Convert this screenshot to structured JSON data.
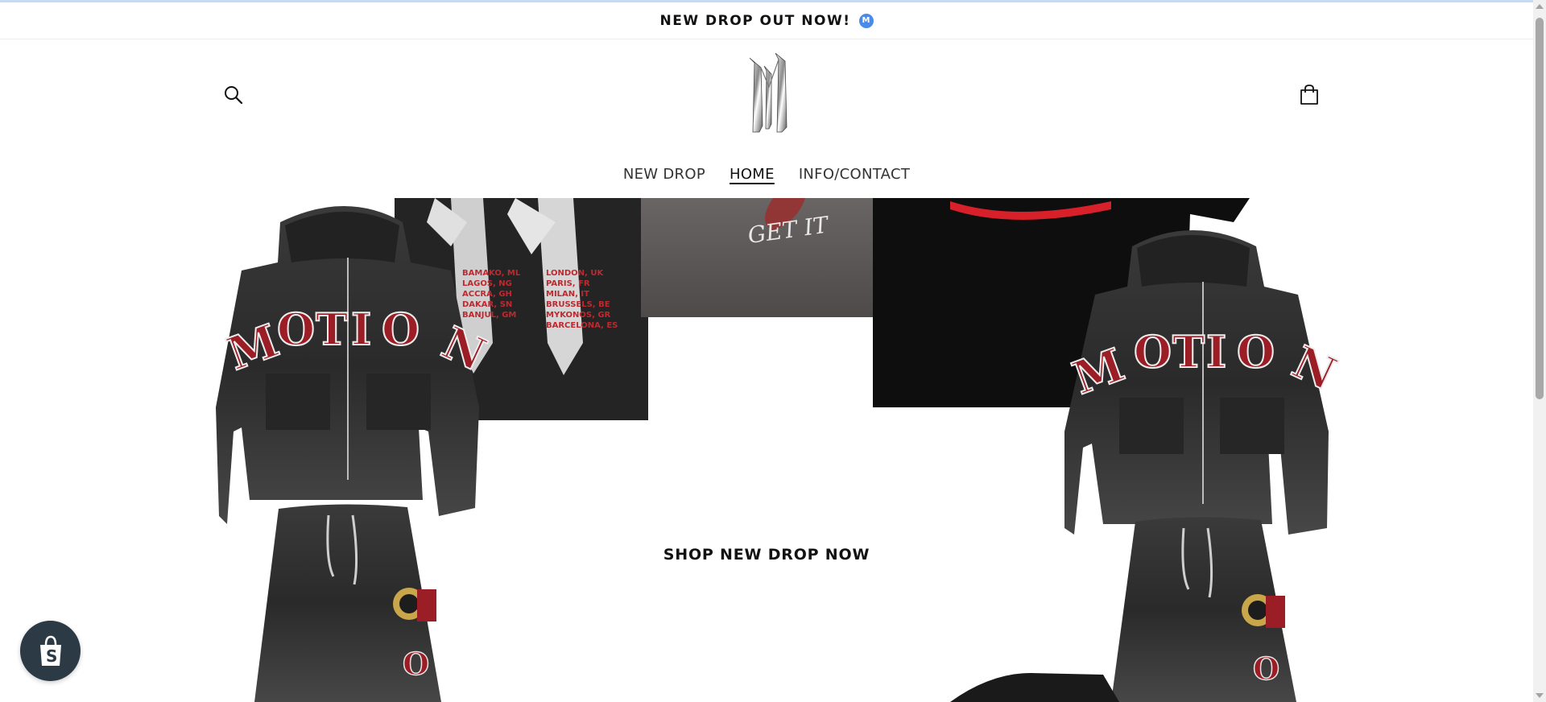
{
  "announcement": {
    "text": "NEW DROP OUT NOW!",
    "badge_letter": "M"
  },
  "header": {
    "search_icon": "search-icon",
    "cart_icon": "cart-icon",
    "logo_alt": "M"
  },
  "nav": {
    "items": [
      {
        "label": "NEW DROP",
        "active": false
      },
      {
        "label": "HOME",
        "active": true
      },
      {
        "label": "INFO/CONTACT",
        "active": false
      }
    ]
  },
  "hero": {
    "cta_label": "SHOP NEW DROP NOW",
    "hoodie_letters": "OTIO",
    "tshirt_cities_left": [
      "BAMAKO, ML",
      "LAGOS, NG",
      "ACCRA, GH",
      "DAKAR, SN",
      "BANJUL, GM"
    ],
    "tshirt_cities_right": [
      "LONDON, UK",
      "PARIS, FR",
      "MILAN, IT",
      "BRUSSELS, BE",
      "MYKONOS, GR",
      "BARCELONA, ES"
    ],
    "grey_tee_text": "GET IT"
  },
  "colors": {
    "accent_blue": "#4c8ae8",
    "garment_dark": "#2b2b2b",
    "print_red": "#b0202a",
    "shopify_badge": "#2b3a44"
  }
}
